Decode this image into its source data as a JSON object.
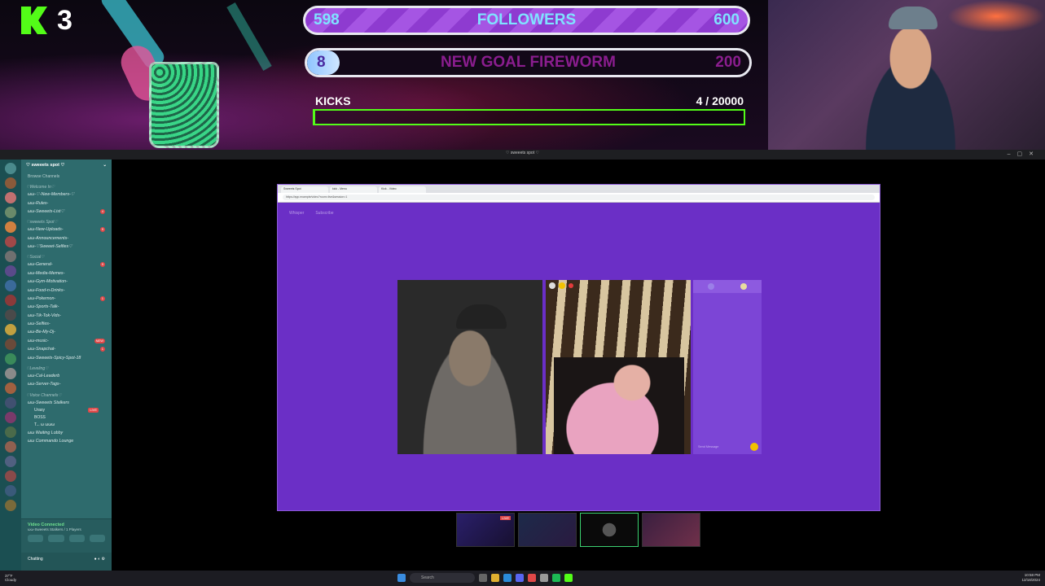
{
  "overlay": {
    "kick_count_badge": "3",
    "followers_goal": {
      "current": "598",
      "label": "FOLLOWERS",
      "target": "600"
    },
    "second_goal": {
      "current": "8",
      "label": "NEW GOAL FIREWORM",
      "target": "200"
    },
    "kicks": {
      "label": "KICKS",
      "count": "4",
      "separator": "/",
      "target": "20000",
      "progress_fraction": 0.0002
    }
  },
  "window": {
    "title": "♡ sweeets spot ♡"
  },
  "discord": {
    "server_name": "♡ sweeets spot ♡",
    "browse": "Browse Channels",
    "categories": [
      {
        "name": "♡Welcome In♡",
        "channels": [
          {
            "name": "ωω-♡-New-Members-♡",
            "badge": ""
          },
          {
            "name": "ωω-Rules-",
            "badge": ""
          },
          {
            "name": "ωω-Sweeets-List♡",
            "badge": "4"
          }
        ]
      },
      {
        "name": "♡sweeets Spot♡",
        "channels": [
          {
            "name": "ωω-New-Uploads-",
            "badge": "9"
          },
          {
            "name": "ωω-Announcements-",
            "badge": ""
          },
          {
            "name": "ωω-♡Sweeet-Selfies♡",
            "badge": ""
          }
        ]
      },
      {
        "name": "♡Social♡",
        "channels": [
          {
            "name": "ωω-General-",
            "badge": "9"
          },
          {
            "name": "ωω-Media-Memes-",
            "badge": ""
          },
          {
            "name": "ωω-Gym-Motivation-",
            "badge": ""
          },
          {
            "name": "ωω-Food-n-Drinks-",
            "badge": ""
          },
          {
            "name": "ωω-Pokemon-",
            "badge": "1"
          },
          {
            "name": "ωω-Sports-Talk-",
            "badge": ""
          },
          {
            "name": "ωω-Tik-Tok-Vids-",
            "badge": ""
          },
          {
            "name": "ωω-Selfies-",
            "badge": ""
          },
          {
            "name": "ωω-Be-My-Dj-",
            "badge": ""
          },
          {
            "name": "ωω-music-",
            "badge": "NEW"
          },
          {
            "name": "ωω-Snapchat-",
            "badge": "1"
          },
          {
            "name": "ωω-Sweeets-Spicy-Spot-18",
            "badge": ""
          }
        ]
      },
      {
        "name": "♡Leveling♡",
        "channels": [
          {
            "name": "ωω-Cal-Leaderb",
            "badge": ""
          },
          {
            "name": "ωω-Server-Tags-",
            "badge": ""
          }
        ]
      },
      {
        "name": "♡Voice Channels♡",
        "channels": [
          {
            "name": "ωω-Sweeets Stalkers",
            "badge": ""
          }
        ]
      }
    ],
    "voice_users": [
      {
        "name": "Urasy",
        "live": "LIVE"
      },
      {
        "name": "BOSS",
        "live": ""
      },
      {
        "name": "T... ω ωωω",
        "live": ""
      }
    ],
    "extra_channels": [
      "ωω Waiting Lobby",
      "ωω Commando Lounge"
    ],
    "voice_connected": "Video Connected",
    "voice_channel": "ωω-Sweeets Stalkers / 1 Players",
    "user_status": "Chatting"
  },
  "browser": {
    "tabs": [
      "Sweeets Spot",
      "kick - Menu",
      "Kick - Video"
    ],
    "url": "https://app.example/video?room=live&session=1",
    "app_nav": [
      "Whisper",
      "Subscribe"
    ],
    "chat_placeholder": "Send Message"
  },
  "thumbs": {
    "live_label": "LIVE"
  },
  "taskbar": {
    "weather_temp": "37°F",
    "weather_desc": "Cloudy",
    "search": "Search",
    "time": "10:58 PM",
    "date": "12/18/2024"
  }
}
